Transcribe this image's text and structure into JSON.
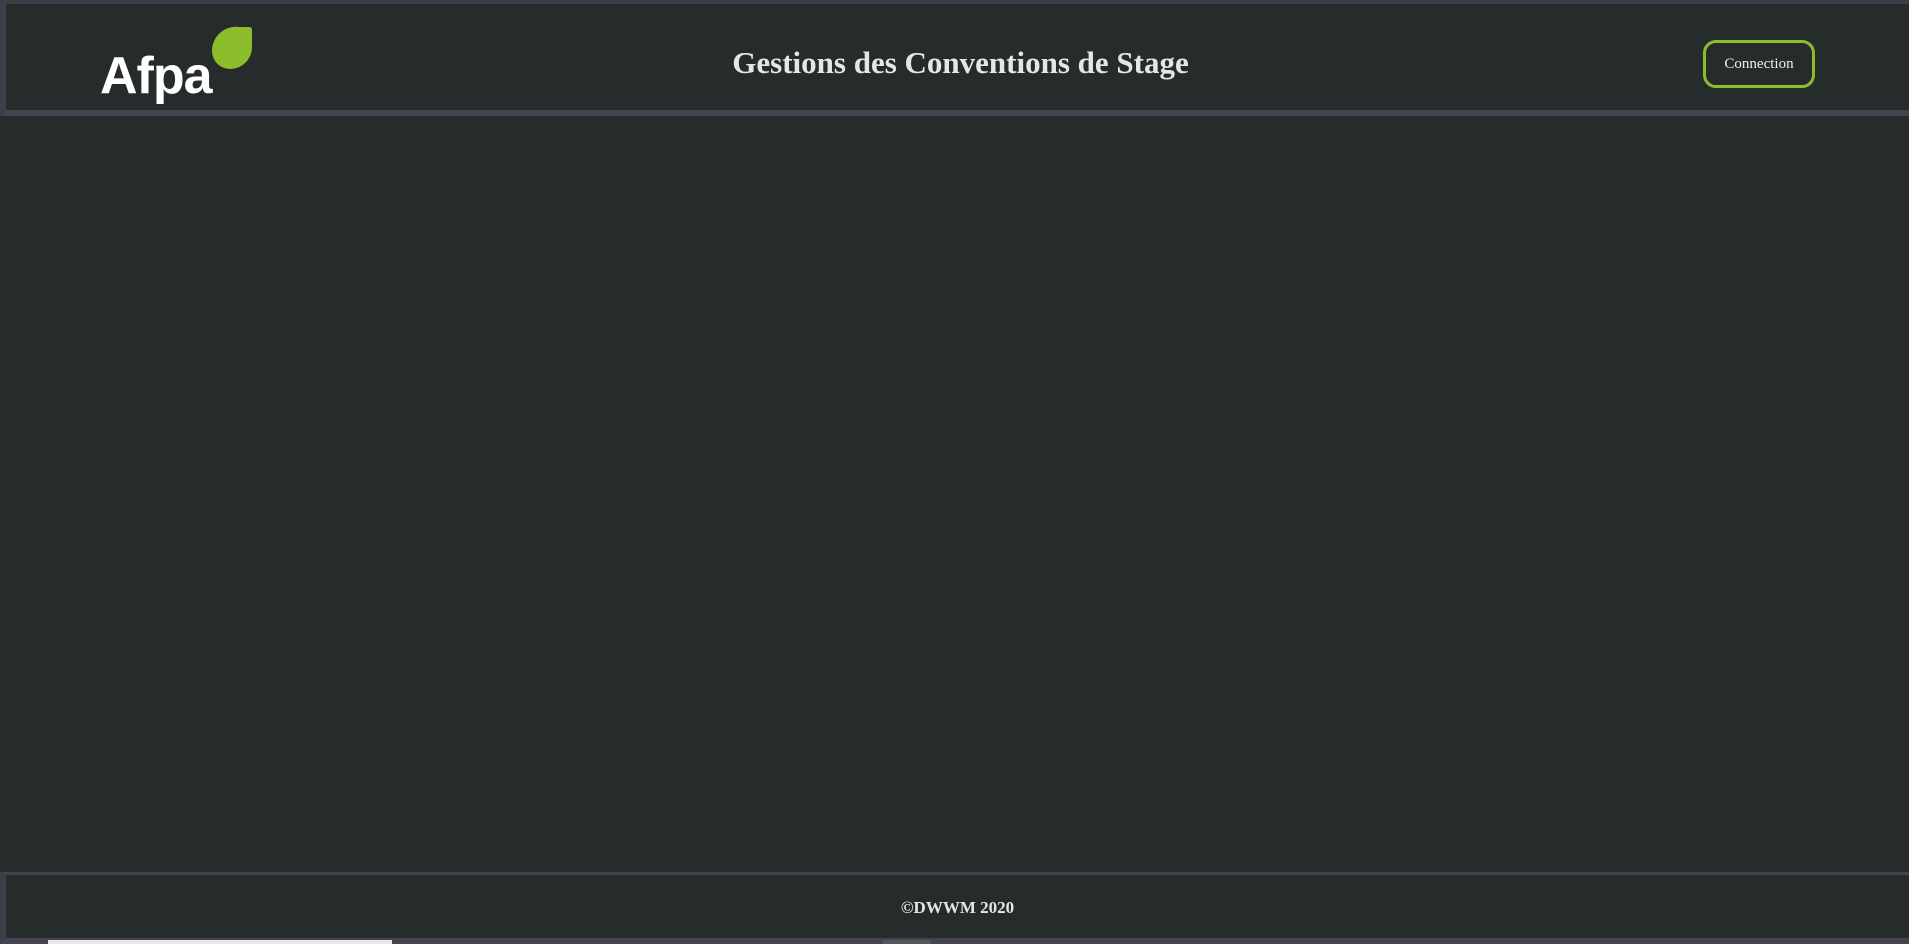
{
  "header": {
    "logo_text": "Afpa",
    "title": "Gestions des Conventions de Stage",
    "connection_label": "Connection"
  },
  "footer": {
    "copyright": "©DWWM 2020"
  },
  "colors": {
    "background": "#262b2c",
    "accent": "#8cbe2c",
    "border": "#45434f",
    "text": "#e6e6e6"
  },
  "icons": {
    "logo": "afpa-leaf-logo"
  }
}
